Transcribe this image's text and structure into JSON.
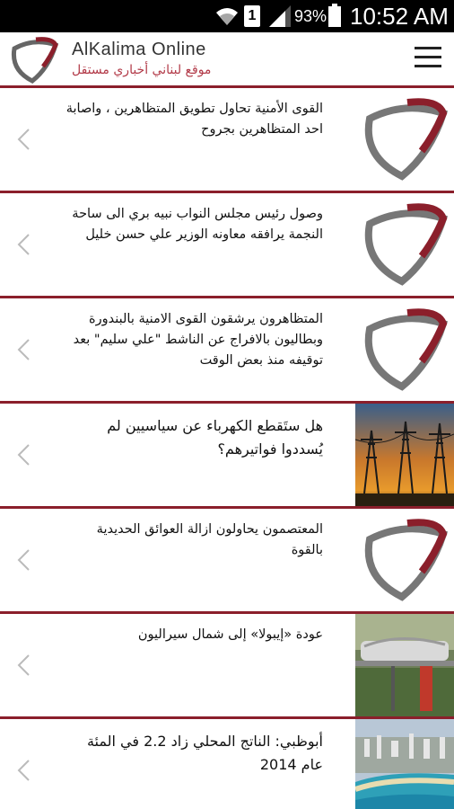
{
  "status_bar": {
    "battery_pct": "93%",
    "time": "10:52 AM",
    "sim_label": "1",
    "icons": [
      "wifi-icon",
      "sim-icon",
      "signal-icon",
      "battery-icon"
    ]
  },
  "header": {
    "title": "AlKalima  Online",
    "subtitle": "موقع لبناني أخباري مستقل",
    "logo": "alkalima-logo",
    "menu_icon": "hamburger-menu-icon",
    "accent_color": "#8b1f2b"
  },
  "articles": [
    {
      "text": "القوى الأمنية تحاول تطويق المتظاهرين ، واصابة احد المتظاهرين بجروح",
      "thumb": "logo"
    },
    {
      "text": "وصول رئيس مجلس النواب نبيه بري الى ساحة النجمة يرافقه معاونه الوزير علي حسن خليل",
      "thumb": "logo"
    },
    {
      "text": "المتظاهرون يرشقون القوى الامنية بالبندورة وبطاليون بالافراج عن الناشط \"علي سليم\" بعد توقيفه منذ بعض الوقت",
      "thumb": "logo"
    },
    {
      "text": "هل ستَقطع الكهرباء عن سياسيين لم يُسددوا فواتيرهم؟",
      "thumb": "power-lines-photo"
    },
    {
      "text": "المعتصمون يحاولون ازالة العوائق الحديدية بالقوة",
      "thumb": "logo"
    },
    {
      "text": "عودة «إيبولا» إلى شمال سيراليون",
      "thumb": "stretcher-photo"
    },
    {
      "text": "أبوظبي: الناتج المحلي زاد 2.2 في المئة عام 2014",
      "thumb": "coastline-photo"
    }
  ]
}
